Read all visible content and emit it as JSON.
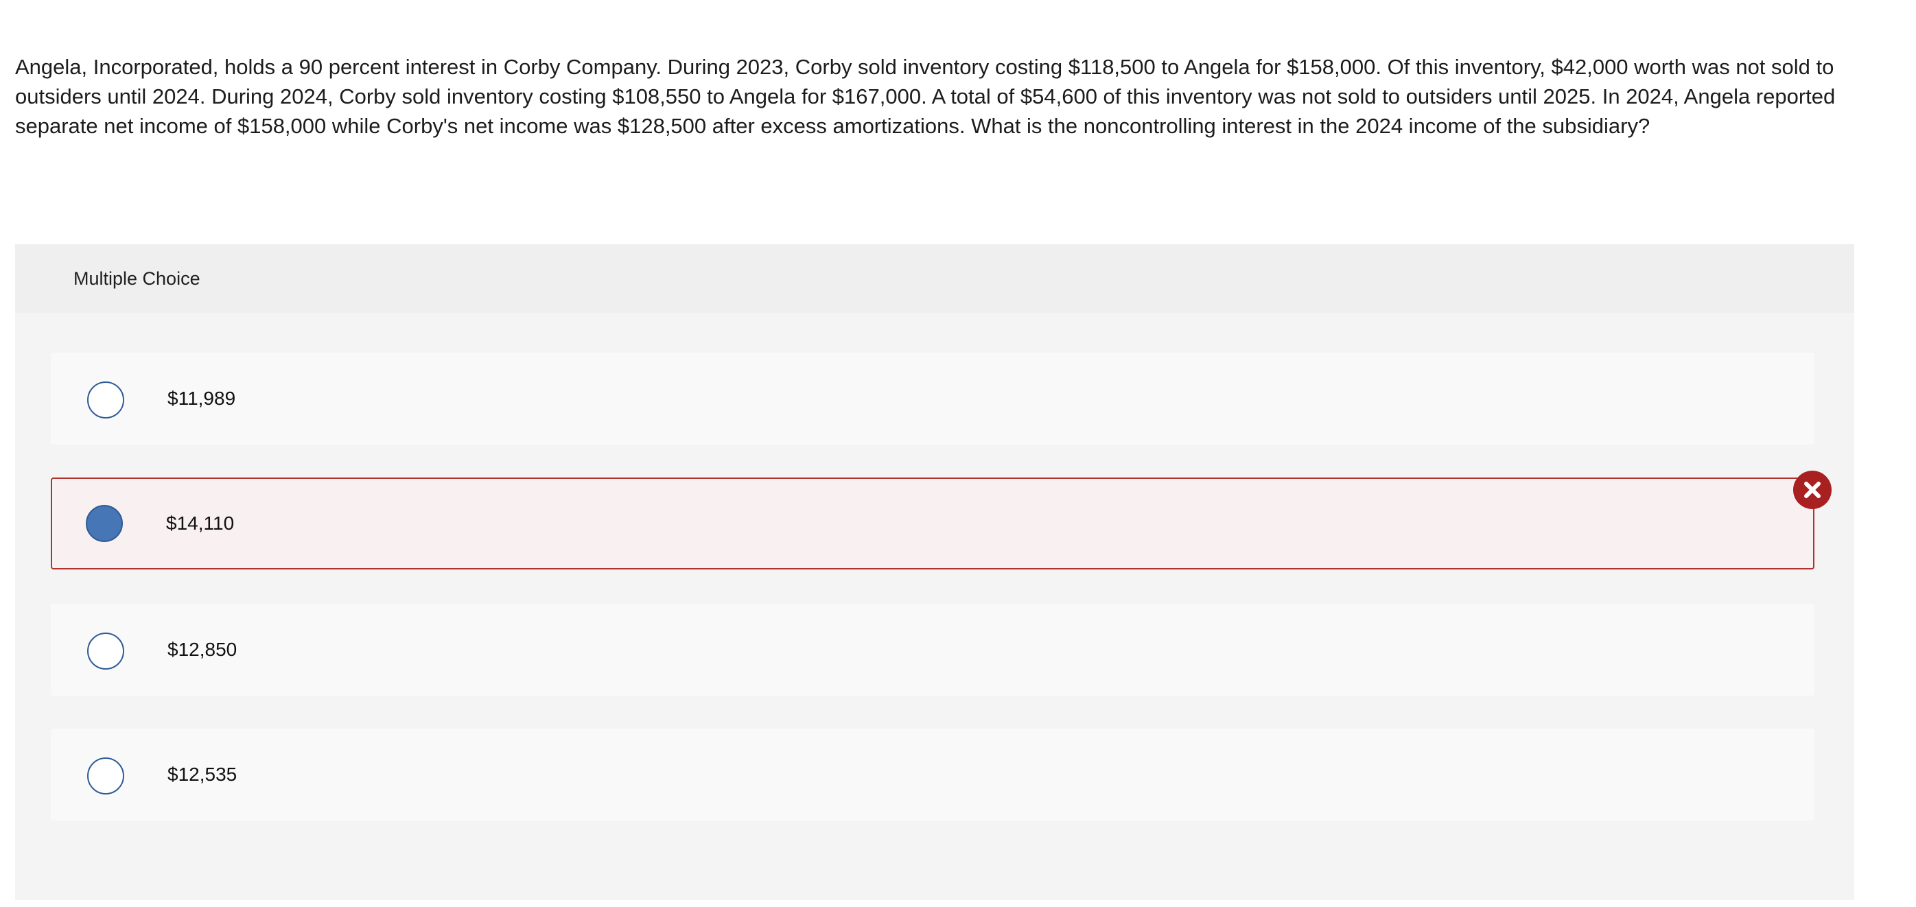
{
  "question": {
    "text": "Angela, Incorporated, holds a 90 percent interest in Corby Company. During 2023, Corby sold inventory costing $118,500 to Angela for $158,000. Of this inventory, $42,000 worth was not sold to outsiders until 2024. During 2024, Corby sold inventory costing $108,550 to Angela for $167,000. A total of $54,600 of this inventory was not sold to outsiders until 2025. In 2024, Angela reported separate net income of $158,000 while Corby's net income was $128,500 after excess amortizations. What is the noncontrolling interest in the 2024 income of the subsidiary?"
  },
  "multiple_choice": {
    "header_label": "Multiple Choice",
    "options": [
      {
        "label": "$11,989",
        "selected": false
      },
      {
        "label": "$14,110",
        "selected": true,
        "status": "incorrect"
      },
      {
        "label": "$12,850",
        "selected": false
      },
      {
        "label": "$12,535",
        "selected": false
      }
    ],
    "incorrect_indicator_icon": "close-icon"
  },
  "colors": {
    "radio_border": "#2e5b96",
    "radio_selected_fill": "#4676b5",
    "incorrect_red": "#b3312d",
    "incorrect_icon_bg": "#a8201f",
    "panel_bg": "#f4f4f4",
    "header_bg": "#efefef"
  }
}
